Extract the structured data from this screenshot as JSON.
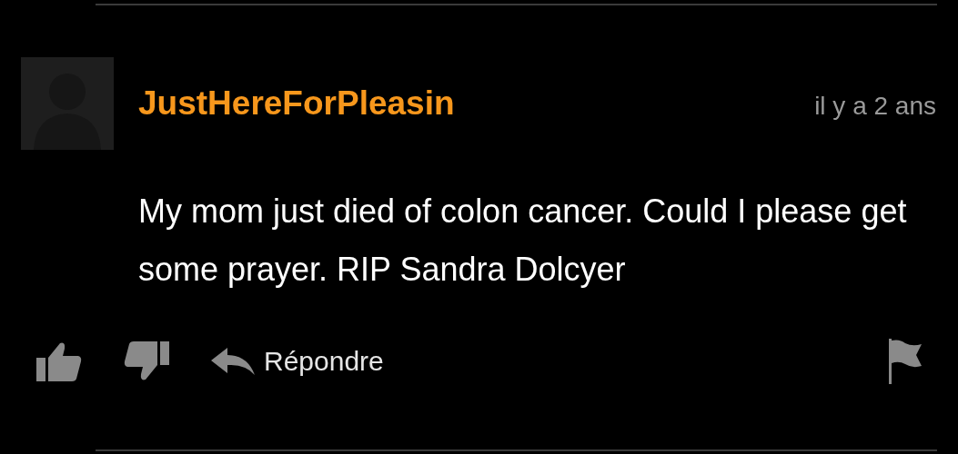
{
  "comment": {
    "author": "JustHereForPleasin",
    "time": "il y a 2 ans",
    "text": "My mom just died of colon cancer. Could I please get some prayer. RIP Sandra Dolcyer",
    "actions": {
      "reply": "Répondre"
    }
  }
}
